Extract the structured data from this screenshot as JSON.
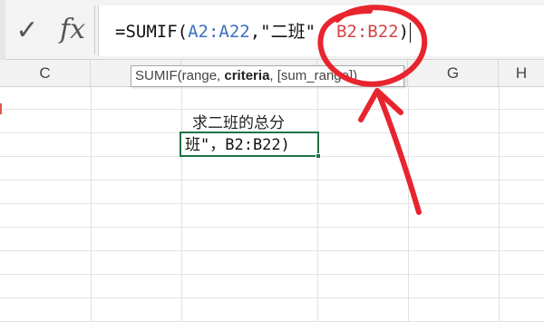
{
  "formula_bar": {
    "cancel_icon": "✓",
    "function_icon": "fx",
    "formula": {
      "prefix": "=SUMIF(",
      "range1": "A2:A22",
      "sep1": ",",
      "criteria": "\"二班\"",
      "sep2": ",",
      "range2": "B2:B22",
      "suffix": ")"
    }
  },
  "columns": {
    "c": "C",
    "g": "G",
    "h": "H"
  },
  "tooltip": {
    "func": "SUMIF(",
    "arg1": "range, ",
    "arg2": "criteria",
    "arg3": ", [sum_range])"
  },
  "cells": {
    "label": "求二班的总分",
    "active_text": "班\"，B2:B22)"
  },
  "colors": {
    "range1": "#3a6fbf",
    "range2": "#d64545",
    "annotation": "#e8242e",
    "active_border": "#217346"
  }
}
